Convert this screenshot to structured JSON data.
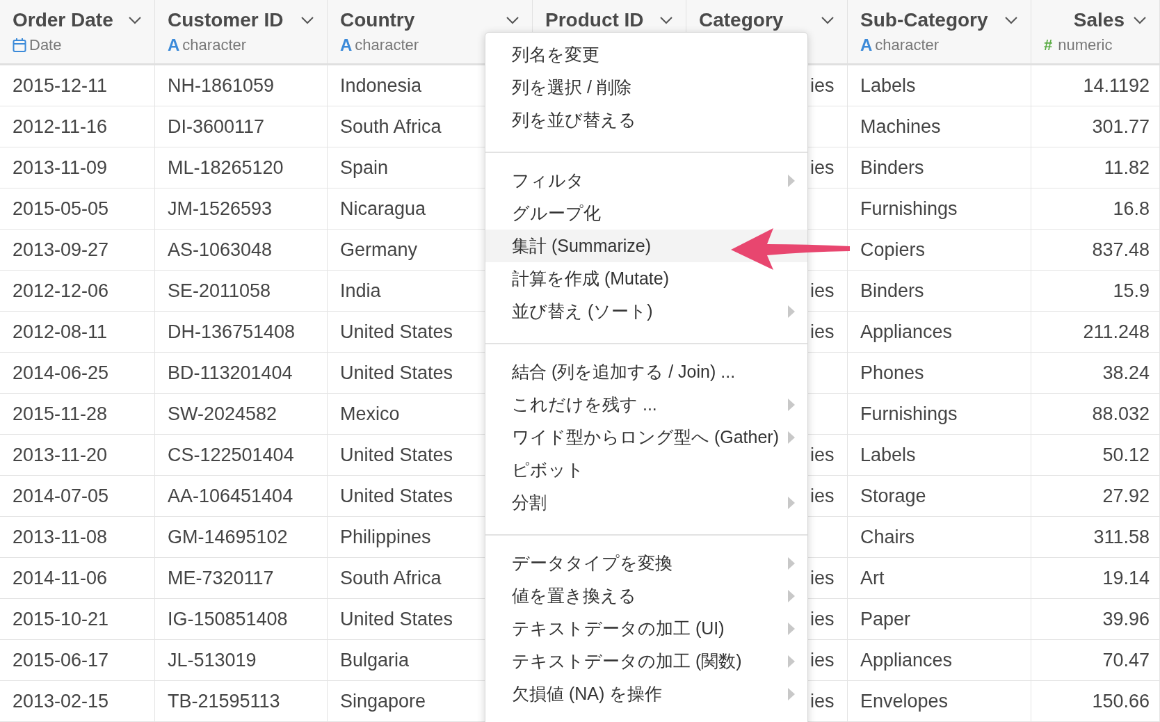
{
  "columns": [
    {
      "name": "Order Date",
      "kind": "date",
      "type_label": "Date"
    },
    {
      "name": "Customer ID",
      "kind": "character",
      "icon_text": "A",
      "type_label": "character"
    },
    {
      "name": "Country",
      "kind": "character",
      "icon_text": "A",
      "type_label": "character"
    },
    {
      "name": "Product ID"
    },
    {
      "name": "Category"
    },
    {
      "name": "Sub-Category",
      "kind": "character",
      "icon_text": "A",
      "type_label": "character"
    },
    {
      "name": "Sales",
      "kind": "numeric",
      "icon_text": "#",
      "type_label": "numeric"
    }
  ],
  "rows": [
    {
      "order_date": "2015-12-11",
      "customer_id": "NH-1861059",
      "country": "Indonesia",
      "category": "ies",
      "sub_category": "Labels",
      "sales": "14.1192"
    },
    {
      "order_date": "2012-11-16",
      "customer_id": "DI-3600117",
      "country": "South Africa",
      "sub_category": "Machines",
      "sales": "301.77"
    },
    {
      "order_date": "2013-11-09",
      "customer_id": "ML-18265120",
      "country": "Spain",
      "category": "ies",
      "sub_category": "Binders",
      "sales": "11.82"
    },
    {
      "order_date": "2015-05-05",
      "customer_id": "JM-1526593",
      "country": "Nicaragua",
      "sub_category": "Furnishings",
      "sales": "16.8"
    },
    {
      "order_date": "2013-09-27",
      "customer_id": "AS-1063048",
      "country": "Germany",
      "sub_category": "Copiers",
      "sales": "837.48"
    },
    {
      "order_date": "2012-12-06",
      "customer_id": "SE-2011058",
      "country": "India",
      "category": "ies",
      "sub_category": "Binders",
      "sales": "15.9"
    },
    {
      "order_date": "2012-08-11",
      "customer_id": "DH-136751408",
      "country": "United States",
      "category": "ies",
      "sub_category": "Appliances",
      "sales": "211.248"
    },
    {
      "order_date": "2014-06-25",
      "customer_id": "BD-113201404",
      "country": "United States",
      "sub_category": "Phones",
      "sales": "38.24"
    },
    {
      "order_date": "2015-11-28",
      "customer_id": "SW-2024582",
      "country": "Mexico",
      "sub_category": "Furnishings",
      "sales": "88.032"
    },
    {
      "order_date": "2013-11-20",
      "customer_id": "CS-122501404",
      "country": "United States",
      "category": "ies",
      "sub_category": "Labels",
      "sales": "50.12"
    },
    {
      "order_date": "2014-07-05",
      "customer_id": "AA-106451404",
      "country": "United States",
      "category": "ies",
      "sub_category": "Storage",
      "sales": "27.92"
    },
    {
      "order_date": "2013-11-08",
      "customer_id": "GM-14695102",
      "country": "Philippines",
      "sub_category": "Chairs",
      "sales": "311.58"
    },
    {
      "order_date": "2014-11-06",
      "customer_id": "ME-7320117",
      "country": "South Africa",
      "category": "ies",
      "sub_category": "Art",
      "sales": "19.14"
    },
    {
      "order_date": "2015-10-21",
      "customer_id": "IG-150851408",
      "country": "United States",
      "category": "ies",
      "sub_category": "Paper",
      "sales": "39.96"
    },
    {
      "order_date": "2015-06-17",
      "customer_id": "JL-513019",
      "country": "Bulgaria",
      "category": "ies",
      "sub_category": "Appliances",
      "sales": "70.47"
    },
    {
      "order_date": "2013-02-15",
      "customer_id": "TB-21595113",
      "country": "Singapore",
      "category": "ies",
      "sub_category": "Envelopes",
      "sales": "150.66"
    }
  ],
  "menu": {
    "sections": [
      [
        {
          "label": "列名を変更",
          "submenu": false,
          "selected": false
        },
        {
          "label": "列を選択 / 削除",
          "submenu": false,
          "selected": false
        },
        {
          "label": "列を並び替える",
          "submenu": false,
          "selected": false
        }
      ],
      [
        {
          "label": "フィルタ",
          "submenu": true,
          "selected": false
        },
        {
          "label": "グループ化",
          "submenu": false,
          "selected": false
        },
        {
          "label": "集計 (Summarize)",
          "submenu": false,
          "selected": true
        },
        {
          "label": "計算を作成 (Mutate)",
          "submenu": false,
          "selected": false
        },
        {
          "label": "並び替え (ソート)",
          "submenu": true,
          "selected": false
        }
      ],
      [
        {
          "label": "結合 (列を追加する / Join) ...",
          "submenu": false,
          "selected": false
        },
        {
          "label": "これだけを残す ...",
          "submenu": true,
          "selected": false
        },
        {
          "label": "ワイド型からロング型へ (Gather)",
          "submenu": true,
          "selected": false
        },
        {
          "label": "ピボット",
          "submenu": false,
          "selected": false
        },
        {
          "label": "分割",
          "submenu": true,
          "selected": false
        }
      ],
      [
        {
          "label": "データタイプを変換",
          "submenu": true,
          "selected": false
        },
        {
          "label": "値を置き換える",
          "submenu": true,
          "selected": false
        },
        {
          "label": "テキストデータの加工 (UI)",
          "submenu": true,
          "selected": false
        },
        {
          "label": "テキストデータの加工 (関数)",
          "submenu": true,
          "selected": false
        },
        {
          "label": "欠損値 (NA) を操作",
          "submenu": true,
          "selected": false
        }
      ]
    ]
  }
}
